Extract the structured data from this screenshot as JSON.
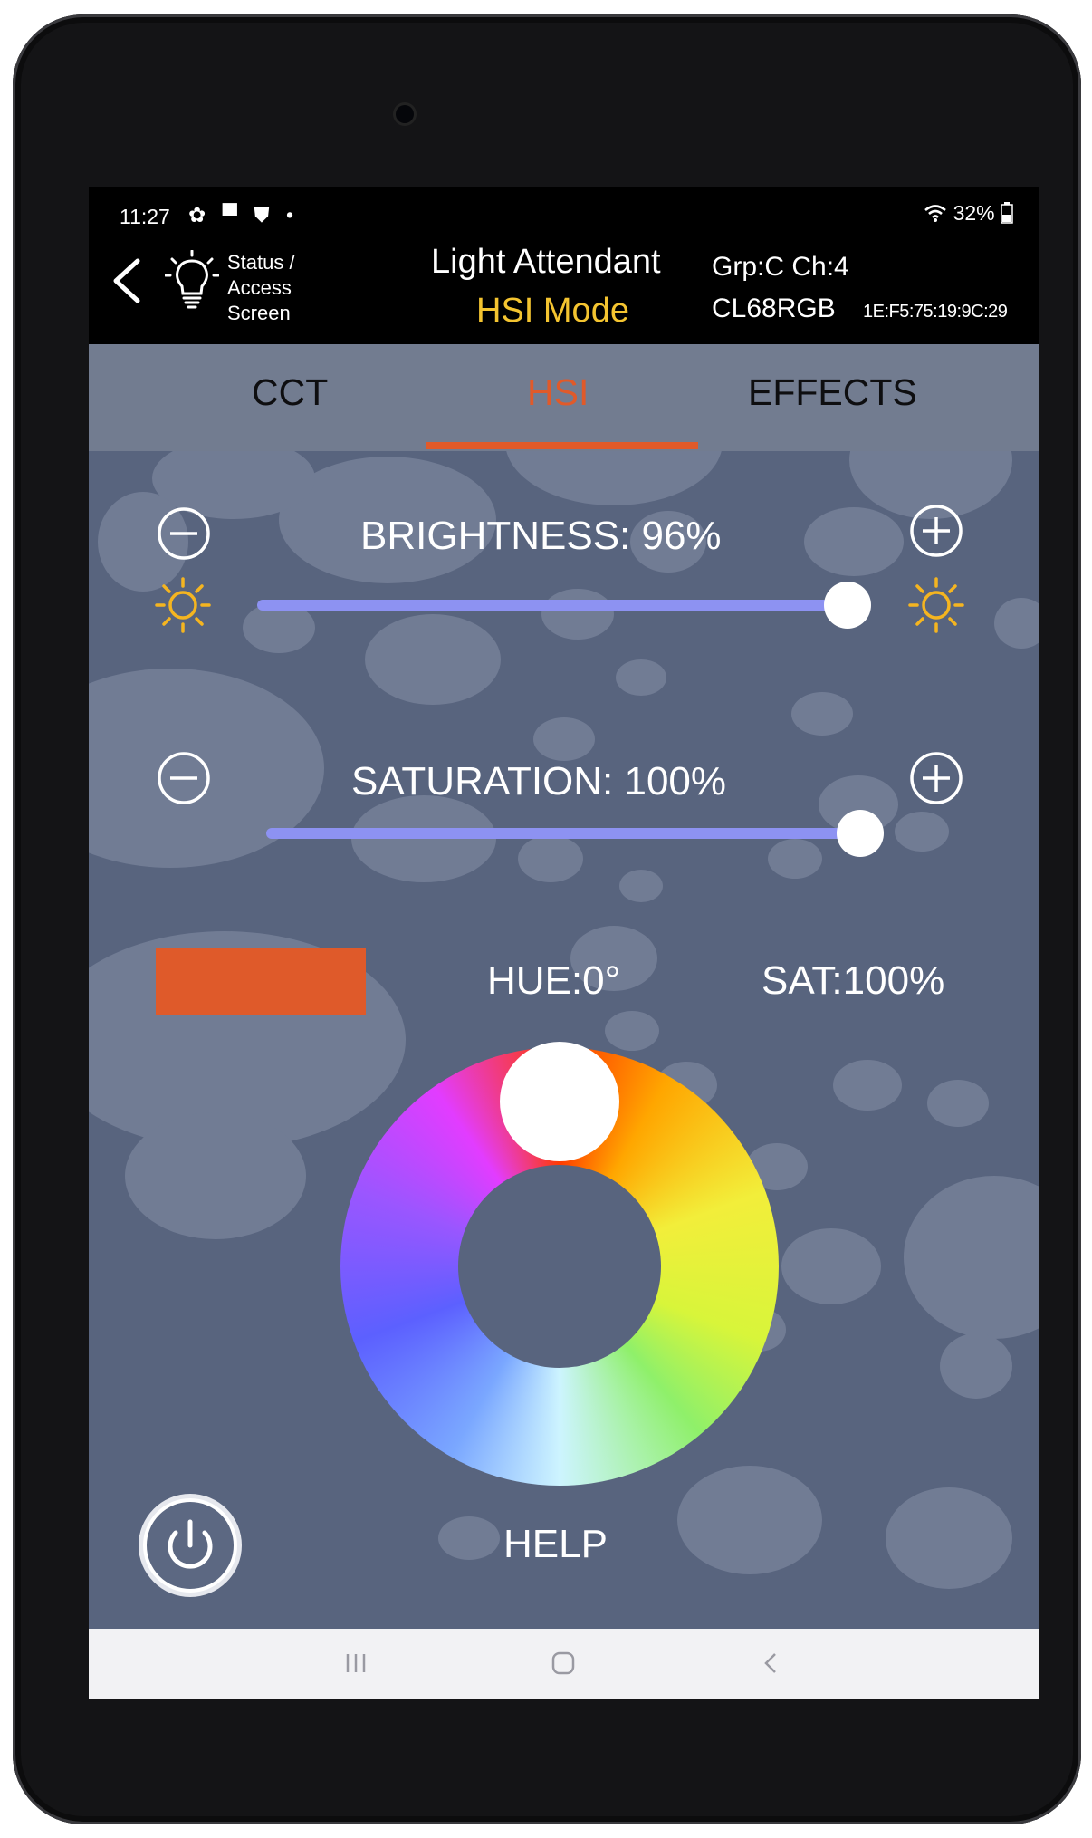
{
  "status_bar": {
    "time": "11:27",
    "icons": "✿ ▀ ⛊ •",
    "battery": "32%"
  },
  "header": {
    "back_label_lines": [
      "Status /",
      "Access",
      "Screen"
    ],
    "app_title": "Light Attendant",
    "group_channel": "Grp:C Ch:4",
    "mode": "HSI Mode",
    "model": "CL68RGB",
    "mac": "1E:F5:75:19:9C:29"
  },
  "tabs": [
    {
      "label": "CCT",
      "active": false
    },
    {
      "label": "HSI",
      "active": true
    },
    {
      "label": "EFFECTS",
      "active": false
    }
  ],
  "brightness": {
    "label": "BRIGHTNESS:  96%",
    "value": 96
  },
  "saturation": {
    "label": "SATURATION:  100%",
    "value": 100
  },
  "hue_readout": "HUE:0°",
  "sat_readout": "SAT:100%",
  "colors": {
    "accent": "#e05a2a",
    "mode_yellow": "#f4c430",
    "slider": "#8d92f2",
    "swatch": "#df5a2a",
    "sun_icon": "#f5b520"
  },
  "help_label": "HELP",
  "icons": {
    "back": "chevron-left-icon",
    "bulb": "lightbulb-icon",
    "minus": "minus-circle-icon",
    "plus": "plus-circle-icon",
    "sun": "sun-icon",
    "power": "power-icon"
  }
}
